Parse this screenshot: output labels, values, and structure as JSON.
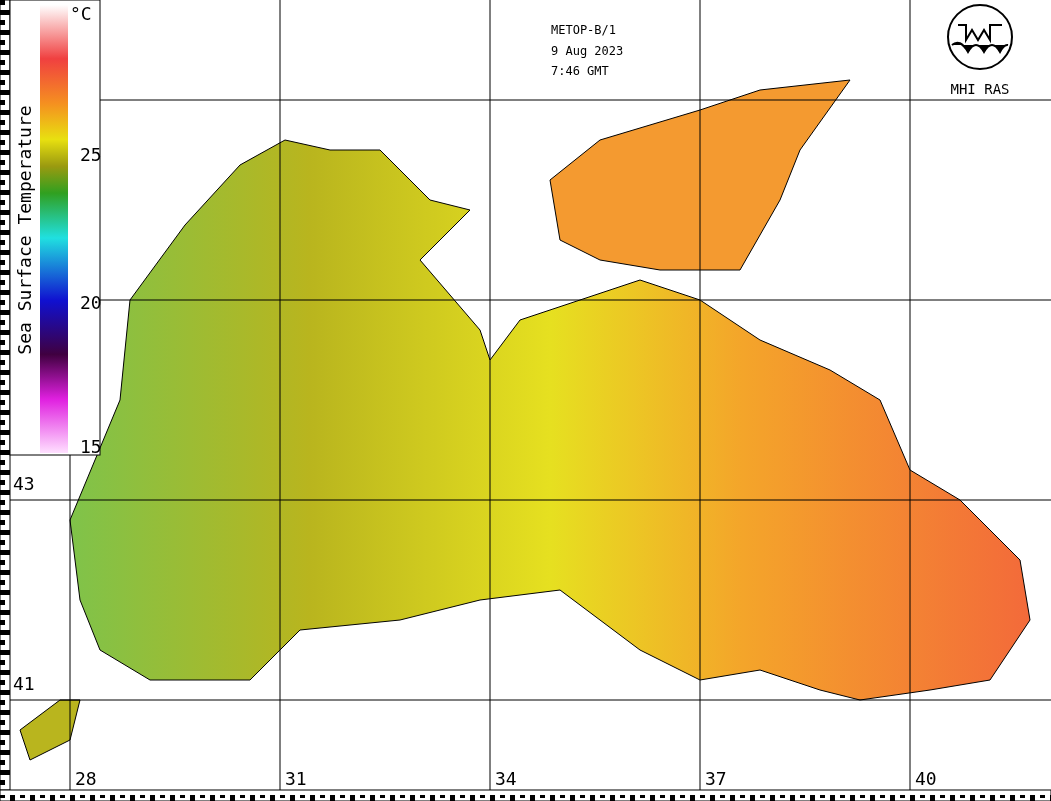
{
  "legend": {
    "title": "Sea Surface Temperature",
    "unit": "°C",
    "ticks": [
      "25",
      "20",
      "15"
    ]
  },
  "header": {
    "satellite": "METOP-B/1",
    "date": "9 Aug 2023",
    "time": "7:46 GMT"
  },
  "logo": {
    "label": "MHI RAS"
  },
  "latitude_labels": [
    "43",
    "41"
  ],
  "longitude_labels": [
    "28",
    "31",
    "34",
    "37",
    "40"
  ]
}
